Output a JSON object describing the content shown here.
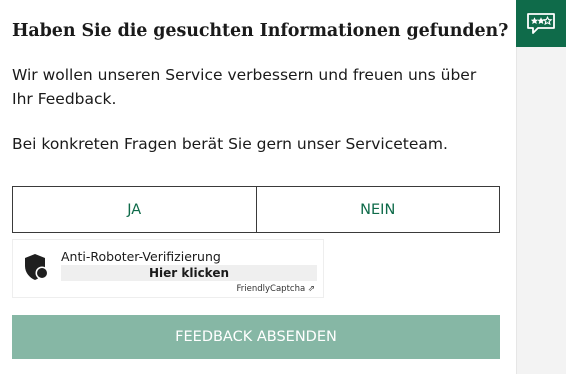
{
  "feedback": {
    "title": "Haben Sie die gesuchten Informationen gefunden?",
    "intro": "Wir wollen unseren Service verbessern und freuen uns über Ihr Feedback.",
    "questions_note": "Bei konkreten Fragen berät Sie gern unser Serviceteam.",
    "yes_label": "JA",
    "no_label": "NEIN",
    "submit_label": "FEEDBACK ABSENDEN"
  },
  "captcha": {
    "title": "Anti-Roboter-Verifizierung",
    "button_label": "Hier klicken",
    "brand": "FriendlyCaptcha ⇗"
  },
  "side_widget": {
    "icon": "rating-speech-bubble-icon"
  },
  "colors": {
    "brand_green": "#0f6b4a",
    "submit_disabled": "#86b7a5",
    "captcha_button_bg": "#efefef"
  }
}
